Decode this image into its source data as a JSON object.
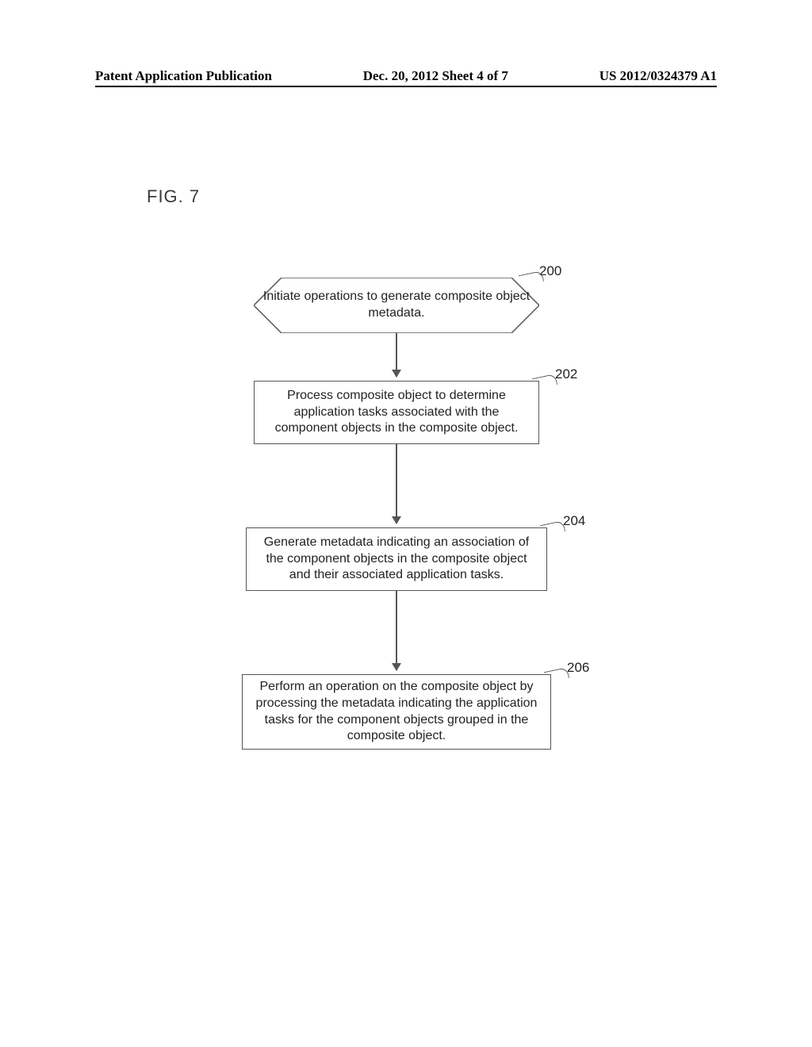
{
  "header": {
    "left": "Patent Application Publication",
    "center": "Dec. 20, 2012  Sheet 4 of 7",
    "right": "US 2012/0324379 A1"
  },
  "figure_label": "FIG. 7",
  "chart_data": {
    "type": "flowchart",
    "nodes": [
      {
        "id": "200",
        "shape": "hexagon",
        "text": "Initiate operations to generate composite object metadata."
      },
      {
        "id": "202",
        "shape": "rect",
        "text": "Process composite object to determine application tasks associated with the component objects in the composite object."
      },
      {
        "id": "204",
        "shape": "rect",
        "text": "Generate metadata indicating an association of the component objects in the composite object and their associated application tasks."
      },
      {
        "id": "206",
        "shape": "rect",
        "text": "Perform an operation on the composite object by processing the metadata indicating the application tasks for the component objects grouped in the composite object."
      }
    ],
    "edges": [
      {
        "from": "200",
        "to": "202"
      },
      {
        "from": "202",
        "to": "204"
      },
      {
        "from": "204",
        "to": "206"
      }
    ]
  }
}
